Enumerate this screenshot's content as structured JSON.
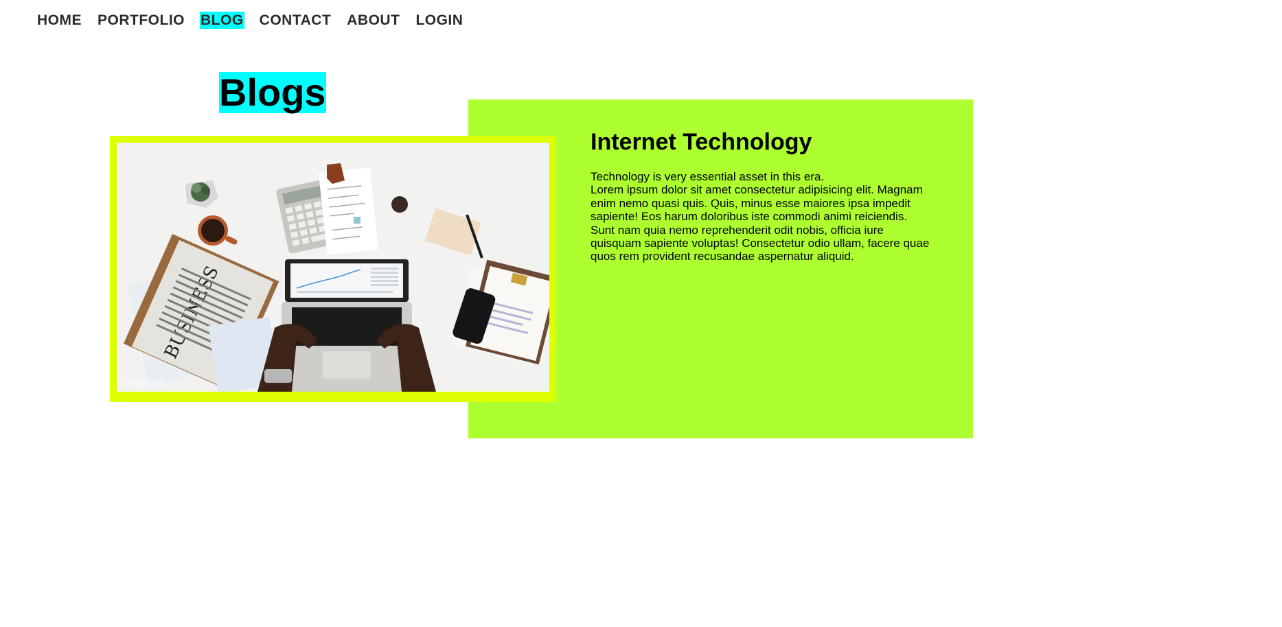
{
  "nav": {
    "items": [
      {
        "label": "HOME",
        "active": false
      },
      {
        "label": "PORTFOLIO",
        "active": false
      },
      {
        "label": "BLOG",
        "active": true
      },
      {
        "label": "CONTACT",
        "active": false
      },
      {
        "label": "ABOUT",
        "active": false
      },
      {
        "label": "LOGIN",
        "active": false
      }
    ],
    "active_highlight_color": "#00ffff"
  },
  "page": {
    "title": "Blogs"
  },
  "post": {
    "title": "Internet Technology",
    "intro": "Technology is very essential asset in this era.",
    "paragraph_1": "Lorem ipsum dolor sit amet consectetur adipisicing elit. Magnam enim nemo quasi quis. Quis, minus esse maiores ipsa impedit sapiente! Eos harum doloribus iste commodi animi reiciendis.",
    "paragraph_2": "Sunt nam quia nemo reprehenderit odit nobis, officia iure quisquam sapiente voluptas! Consectetur odio ullam, facere quae quos rem provident recusandae aspernatur aliquid.",
    "image": {
      "description_icon": "workspace-photo",
      "watermark": "rawpixel",
      "newspaper_heading": "BUSINESS"
    }
  },
  "colors": {
    "panel": "#adff2f",
    "image_frame": "#ddff00",
    "title_highlight": "#00ffff"
  }
}
